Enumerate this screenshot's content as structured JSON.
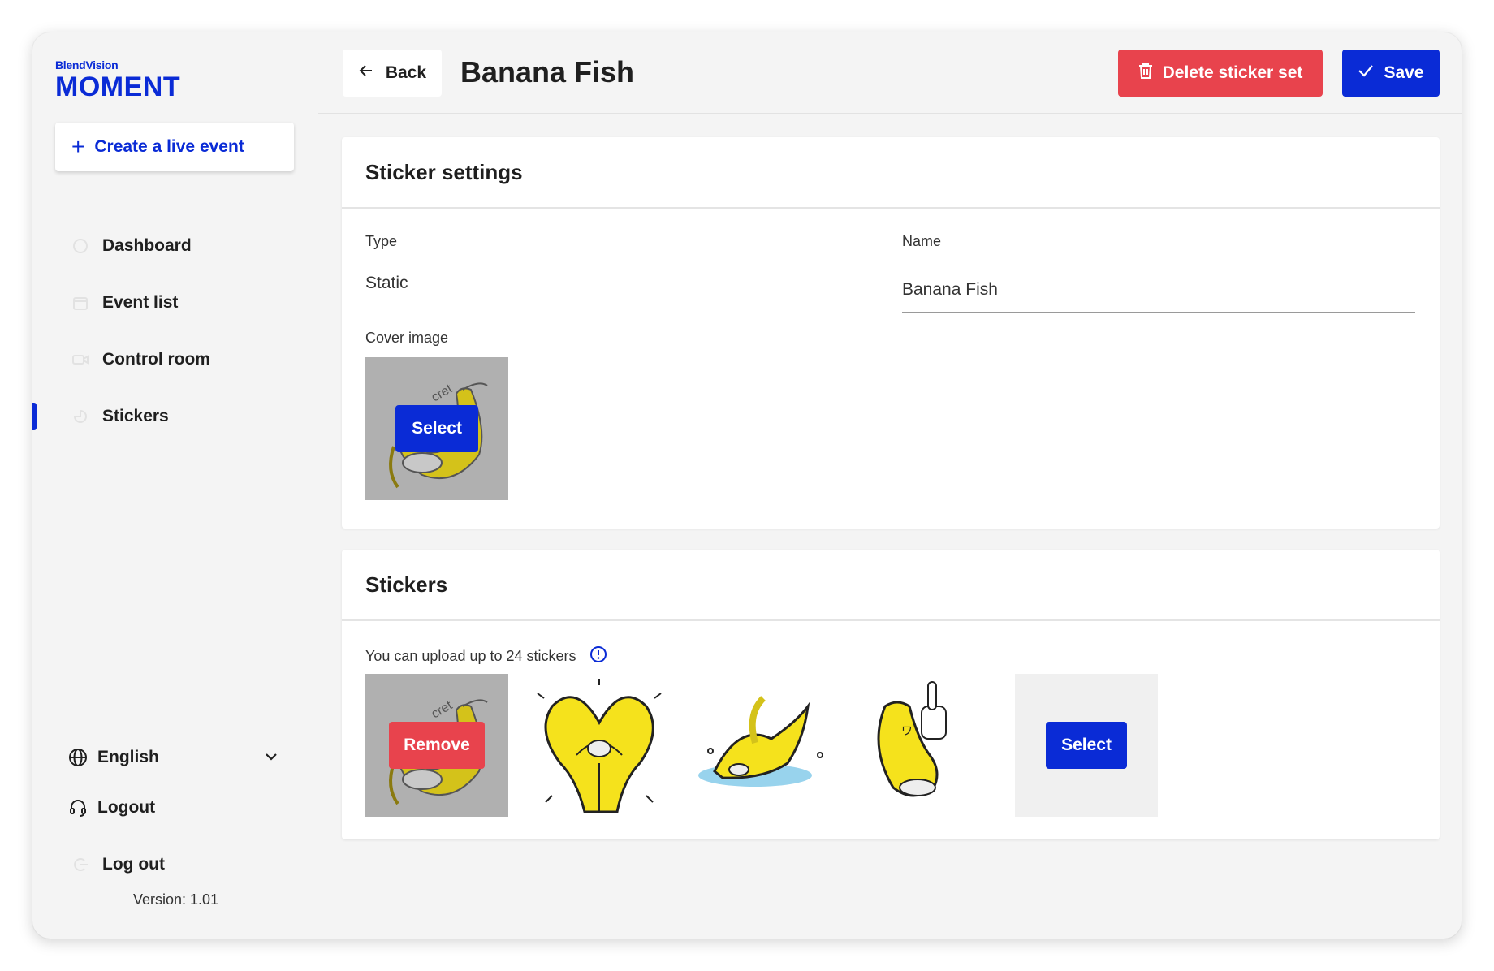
{
  "brand": {
    "small": "BlendVision",
    "big": "MOMENT"
  },
  "sidebar": {
    "create_label": "Create a live event",
    "items": [
      {
        "label": "Dashboard",
        "icon": "dashboard-icon"
      },
      {
        "label": "Event list",
        "icon": "calendar-icon"
      },
      {
        "label": "Control room",
        "icon": "video-camera-icon"
      },
      {
        "label": "Stickers",
        "icon": "sticker-icon",
        "active": true
      }
    ],
    "language": "English",
    "logout_label": "Logout",
    "log_out_label": "Log out",
    "version": "Version: 1.01"
  },
  "header": {
    "back_label": "Back",
    "title": "Banana Fish",
    "delete_label": "Delete sticker set",
    "save_label": "Save"
  },
  "settings": {
    "heading": "Sticker settings",
    "type_label": "Type",
    "type_value": "Static",
    "name_label": "Name",
    "name_value": "Banana Fish",
    "cover_label": "Cover image",
    "cover_select_label": "Select"
  },
  "stickers": {
    "heading": "Stickers",
    "note": "You can upload up to 24 stickers",
    "remove_label": "Remove",
    "select_label": "Select"
  },
  "colors": {
    "primary": "#0a2bd6",
    "danger": "#e8434d",
    "banana": "#f5e21c"
  }
}
